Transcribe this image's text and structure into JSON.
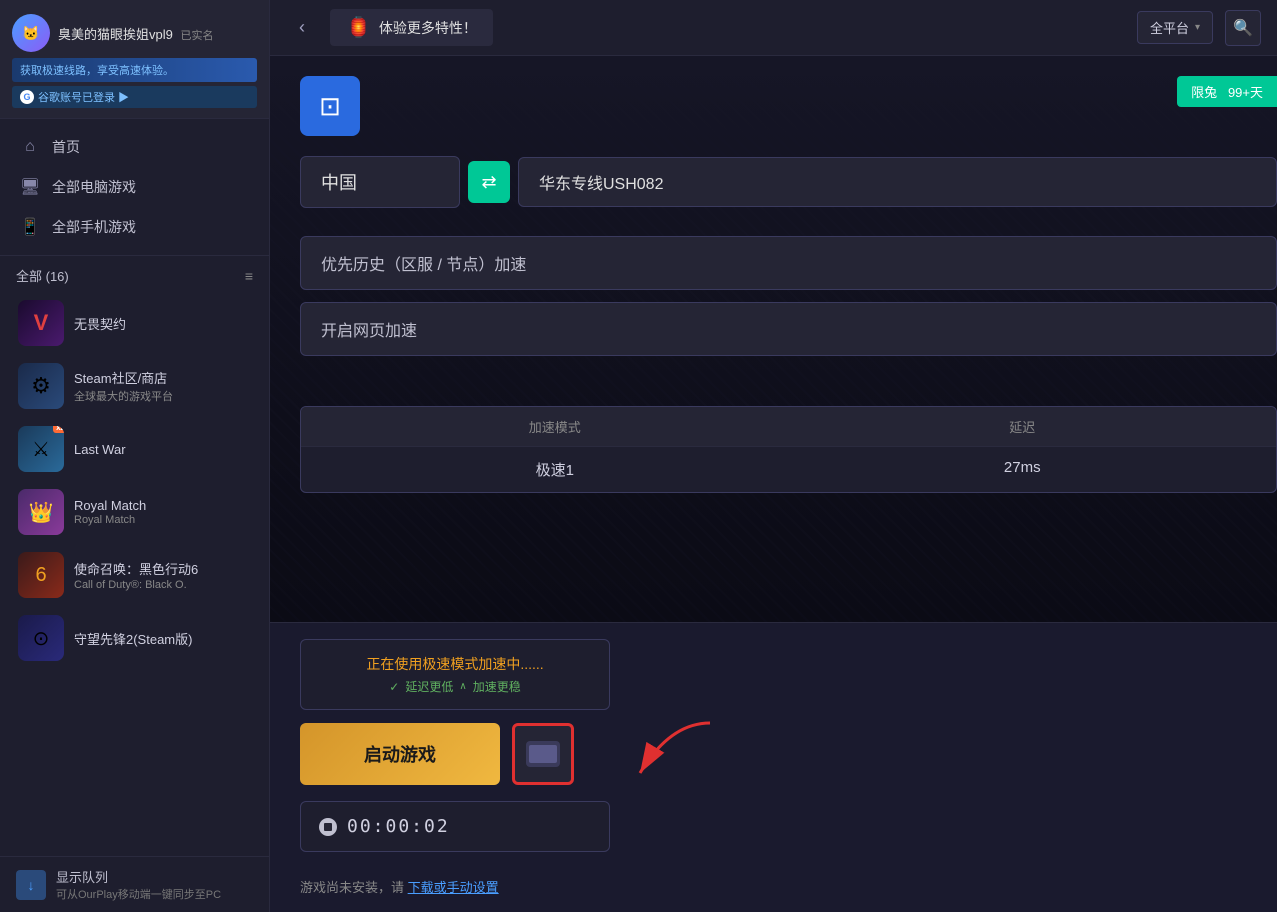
{
  "user": {
    "name": "臭美的猫眼挨姐vpl9",
    "verified": "已实名",
    "promo": "获取极速线路，享受高速体验。",
    "google_login": "谷歌账号已登录 ▶"
  },
  "nav": {
    "home": "首页",
    "pc_games": "全部电脑游戏",
    "mobile_games": "全部手机游戏"
  },
  "games_header": {
    "label": "全部 (16)"
  },
  "games": [
    {
      "name": "无畏契约",
      "subtitle": "",
      "icon_type": "wuji"
    },
    {
      "name": "Steam社区/商店",
      "subtitle": "全球最大的游戏平台",
      "icon_type": "steam"
    },
    {
      "name": "Last War",
      "subtitle": "",
      "icon_type": "lastwar"
    },
    {
      "name": "Royal Match",
      "subtitle": "Royal Match",
      "icon_type": "royalmatch"
    },
    {
      "name": "使命召唤：黑色行动6",
      "subtitle": "Call of Duty®: Black O.",
      "icon_type": "cod"
    },
    {
      "name": "守望先锋2(Steam版)",
      "subtitle": "",
      "icon_type": "overwatch"
    }
  ],
  "bottom_bar": {
    "icon": "↓",
    "text": "显示队列",
    "subtitle": "可从OurPlay移动端一键同步至PC"
  },
  "topbar": {
    "back": "‹",
    "festival_icon": "🏮",
    "festival_text": "体验更多特性！",
    "platform": "全平台",
    "search_icon": "🔍"
  },
  "vpn_card": {
    "icon": "⊡",
    "limit_label": "限兔",
    "limit_value": "99+天"
  },
  "server": {
    "from": "中国",
    "switch_icon": "⇄",
    "to": "华东专线USH082"
  },
  "priority_btn": "优先历史（区服 / 节点）加速",
  "web_accel_btn": "开启网页加速",
  "speed_table": {
    "headers": [
      "加速模式",
      "延迟"
    ],
    "rows": [
      [
        "极速1",
        "27ms"
      ]
    ]
  },
  "status": {
    "active_text": "正在使用极速模式加速中......",
    "sub1": "延迟更低",
    "sub2": "加速更稳",
    "check_icon": "✓",
    "arrow_icon": "∧"
  },
  "start_btn_label": "启动游戏",
  "timer": "00:00:02",
  "install_note": "游戏尚未安装，请",
  "install_link": "下载或手动设置"
}
